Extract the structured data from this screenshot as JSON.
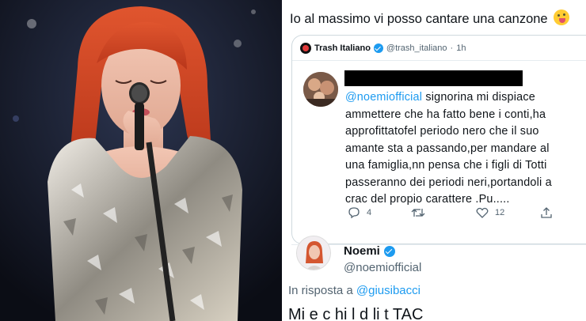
{
  "post": {
    "text": "Io al massimo vi posso cantare una canzone"
  },
  "quoted": {
    "account_name": "Trash Italiano",
    "account_handle": "@trash_italiano",
    "separator": "·",
    "age": "1h",
    "reply": {
      "mention": "@noemiofficial",
      "line1_rest": " signorina mi dispiace",
      "lines": [
        "ammettere che ha fatto bene i conti,ha",
        "approfittatofel periodo nero che il suo",
        "amante sta a passando,per mandare al",
        "una famiglia,nn pensa che i figli di Totti",
        "passeranno dei periodi neri,portandoli a",
        "crac del propio carattere .Pu....."
      ],
      "stats": {
        "replies": "4",
        "retweets": "",
        "likes": "12"
      }
    }
  },
  "response": {
    "name": "Noemi",
    "handle": "@noemiofficial",
    "in_reply_prefix": "In risposta a",
    "in_reply_mention": "@giusibacci",
    "text_cut": "Mi e c hi l d li t  TAC"
  },
  "colors": {
    "link": "#1d9bf0",
    "verified": "#1d9bf0",
    "muted": "#536471"
  }
}
